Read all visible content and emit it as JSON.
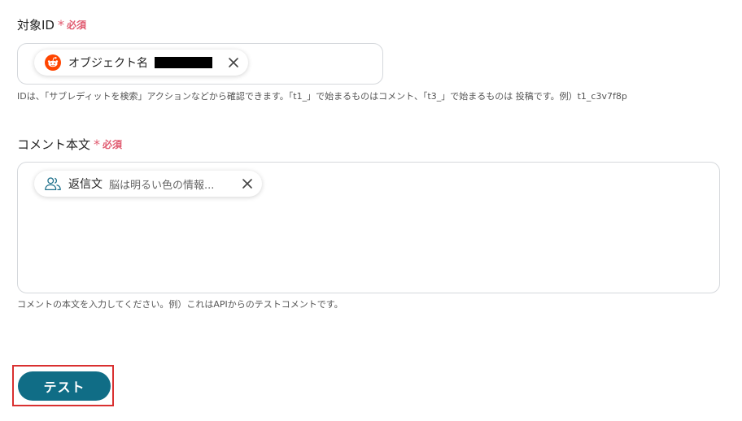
{
  "target_id_field": {
    "label": "対象ID",
    "required_mark": "*",
    "required_text": "必須",
    "chip": {
      "icon": "reddit-icon",
      "name": "オブジェクト名"
    },
    "help": "IDは、「サブレディットを検索」アクションなどから確認できます。「t1_」で始まるものはコメント、「t3_」で始まるものは 投稿です。例）t1_c3v7f8p"
  },
  "comment_body_field": {
    "label": "コメント本文",
    "required_mark": "*",
    "required_text": "必須",
    "chip": {
      "icon": "users-icon",
      "name": "返信文",
      "value": "脳は明るい色の情報..."
    },
    "help": "コメントの本文を入力してください。例）これはAPIからのテストコメントです。"
  },
  "actions": {
    "test_label": "テスト"
  },
  "colors": {
    "required": "#e05a6f",
    "button": "#106d86",
    "highlight_border": "#d93030",
    "reddit": "#ff4500"
  }
}
